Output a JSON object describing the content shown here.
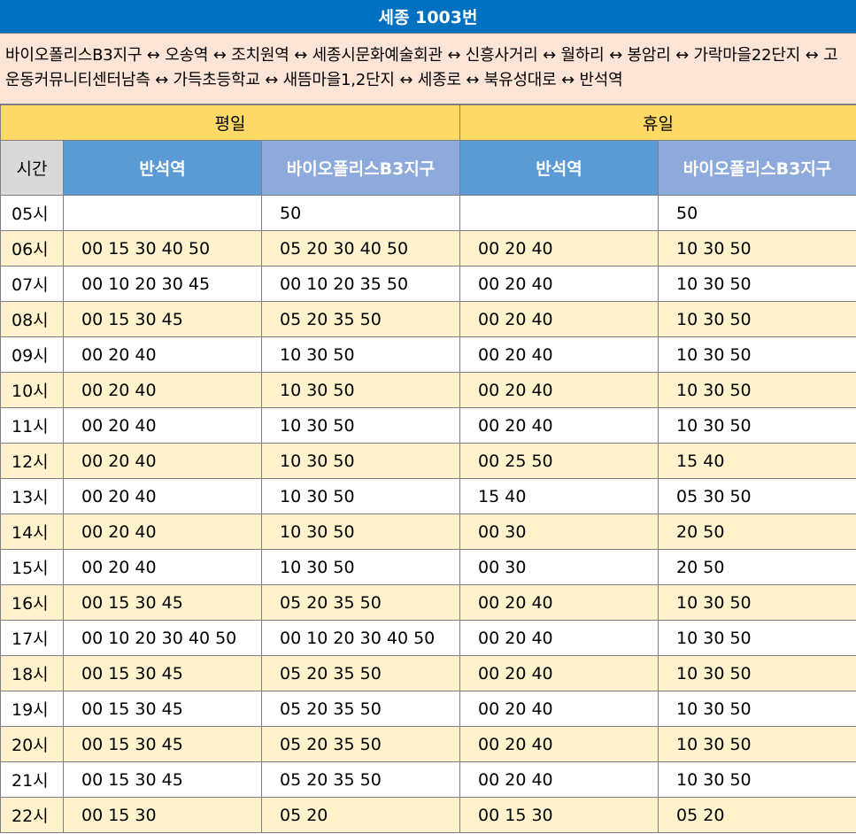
{
  "title": "세종 1003번",
  "route": "바이오폴리스B3지구 ↔ 오송역 ↔ 조치원역 ↔ 세종시문화예술회관 ↔ 신흥사거리 ↔ 월하리 ↔ 봉암리 ↔ 가락마을22단지 ↔ 고운동커뮤니티센터남측 ↔ 가득초등학교 ↔ 새뜸마을1,2단지 ↔ 세종로 ↔ 북유성대로 ↔ 반석역",
  "periods": [
    "평일",
    "휴일"
  ],
  "columns": {
    "time": "시간",
    "stop_a": "반석역",
    "stop_b": "바이오폴리스B3지구"
  },
  "rows": [
    {
      "hour": "05시",
      "wd_a": "",
      "wd_b": "50",
      "we_a": "",
      "we_b": "50"
    },
    {
      "hour": "06시",
      "wd_a": "00 15 30 40 50",
      "wd_b": "05 20 30 40 50",
      "we_a": "00 20 40",
      "we_b": "10 30 50"
    },
    {
      "hour": "07시",
      "wd_a": "00 10 20 30 45",
      "wd_b": "00 10 20 35 50",
      "we_a": "00 20 40",
      "we_b": "10 30 50"
    },
    {
      "hour": "08시",
      "wd_a": "00 15 30 45",
      "wd_b": "05 20 35 50",
      "we_a": "00 20 40",
      "we_b": "10 30 50"
    },
    {
      "hour": "09시",
      "wd_a": "00 20 40",
      "wd_b": "10 30 50",
      "we_a": "00 20 40",
      "we_b": "10 30 50"
    },
    {
      "hour": "10시",
      "wd_a": "00 20 40",
      "wd_b": "10 30 50",
      "we_a": "00 20 40",
      "we_b": "10 30 50"
    },
    {
      "hour": "11시",
      "wd_a": "00 20 40",
      "wd_b": "10 30 50",
      "we_a": "00 20 40",
      "we_b": "10 30 50"
    },
    {
      "hour": "12시",
      "wd_a": "00 20 40",
      "wd_b": "10 30 50",
      "we_a": "00 25 50",
      "we_b": "15 40"
    },
    {
      "hour": "13시",
      "wd_a": "00 20 40",
      "wd_b": "10 30 50",
      "we_a": "15 40",
      "we_b": "05 30 50"
    },
    {
      "hour": "14시",
      "wd_a": "00 20 40",
      "wd_b": "10 30 50",
      "we_a": "00 30",
      "we_b": "20 50"
    },
    {
      "hour": "15시",
      "wd_a": "00 20 40",
      "wd_b": "10 30 50",
      "we_a": "00 30",
      "we_b": "20 50"
    },
    {
      "hour": "16시",
      "wd_a": "00 15 30 45",
      "wd_b": "05 20 35 50",
      "we_a": "00 20 40",
      "we_b": "10 30 50"
    },
    {
      "hour": "17시",
      "wd_a": "00 10 20 30 40 50",
      "wd_b": "00 10 20 30 40 50",
      "we_a": "00 20 40",
      "we_b": "10 30 50"
    },
    {
      "hour": "18시",
      "wd_a": "00 15 30 45",
      "wd_b": "05 20 35 50",
      "we_a": "00 20 40",
      "we_b": "10 30 50"
    },
    {
      "hour": "19시",
      "wd_a": "00 15 30 45",
      "wd_b": "05 20 35 50",
      "we_a": "00 20 40",
      "we_b": "10 30 50"
    },
    {
      "hour": "20시",
      "wd_a": "00 15 30 45",
      "wd_b": "05 20 35 50",
      "we_a": "00 20 40",
      "we_b": "10 30 50"
    },
    {
      "hour": "21시",
      "wd_a": "00 15 30 45",
      "wd_b": "05 20 35 50",
      "we_a": "00 20 40",
      "we_b": "10 30 50"
    },
    {
      "hour": "22시",
      "wd_a": "00 15 30",
      "wd_b": "05 20",
      "we_a": "00 15 30",
      "we_b": "05 20"
    }
  ]
}
